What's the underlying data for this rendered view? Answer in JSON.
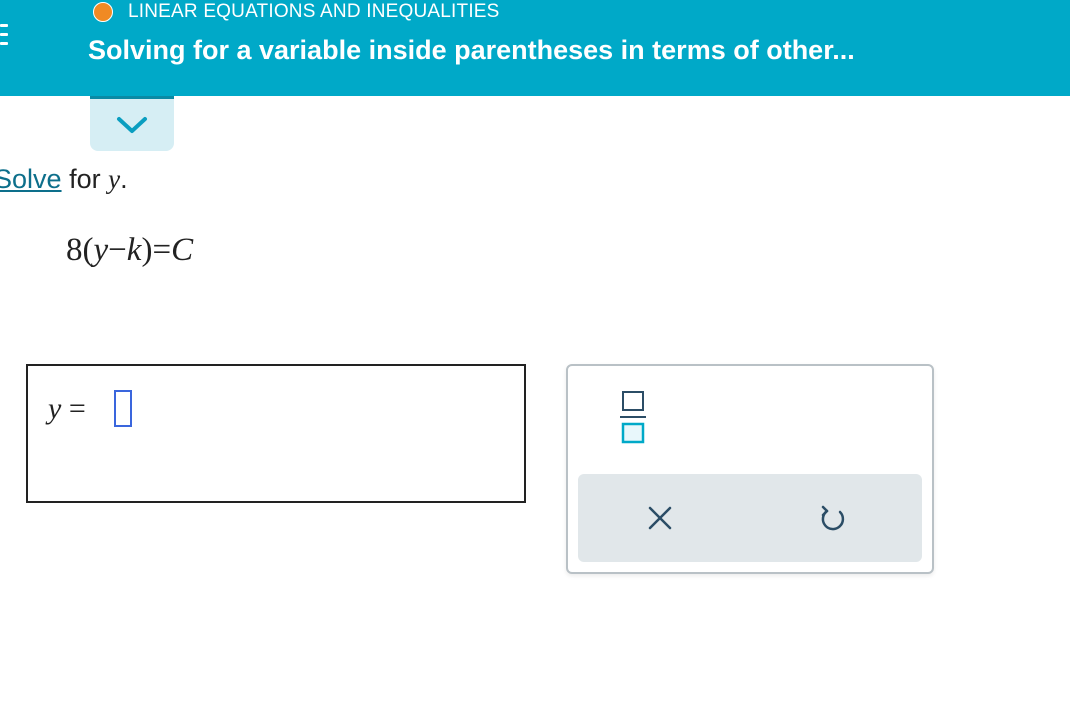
{
  "header": {
    "topic": "LINEAR EQUATIONS AND INEQUALITIES",
    "title": "Solving for a variable inside parentheses in terms of other...",
    "topic_dot_color": "#f08a24",
    "background_color": "#00a9c8"
  },
  "problem": {
    "prompt_link": "Solve",
    "prompt_text": "for",
    "variable": "y",
    "period": ".",
    "equation": {
      "coefficient": "8",
      "open_paren": "(",
      "var1": "y",
      "minus": "−",
      "var2": "k",
      "close_paren": ")",
      "equals": "=",
      "rhs": "C"
    }
  },
  "answer": {
    "label_var": "y",
    "label_equals": "=",
    "value": ""
  },
  "palette": {
    "buttons": [
      "fraction-icon",
      "clear-icon",
      "undo-icon"
    ]
  }
}
